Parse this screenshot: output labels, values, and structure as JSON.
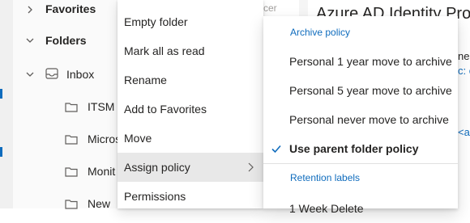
{
  "folder_pane": {
    "favorites": "Favorites",
    "folders": "Folders",
    "inbox": "Inbox",
    "subfolders": [
      "ITSM",
      "Micros",
      "Monit",
      "New"
    ]
  },
  "background": {
    "message_snippet": "cer",
    "reading_title": "Azure AD Identity Pro",
    "reading_line1": "nes",
    "reading_line2": "c: co",
    "reading_line3": "<a",
    "accent": "#0f6cbd"
  },
  "context_menu": {
    "items": [
      "Empty folder",
      "Mark all as read",
      "Rename",
      "Add to Favorites",
      "Move",
      "Assign policy",
      "Permissions"
    ],
    "active_item": "Assign policy"
  },
  "submenu": {
    "archive_header": "Archive policy",
    "archive_items": [
      "Personal 1 year move to archive",
      "Personal 5 year move to archive",
      "Personal never move to archive",
      "Use parent folder policy"
    ],
    "selected": "Use parent folder policy",
    "retention_header": "Retention labels",
    "retention_items": [
      "1 Week Delete"
    ]
  }
}
